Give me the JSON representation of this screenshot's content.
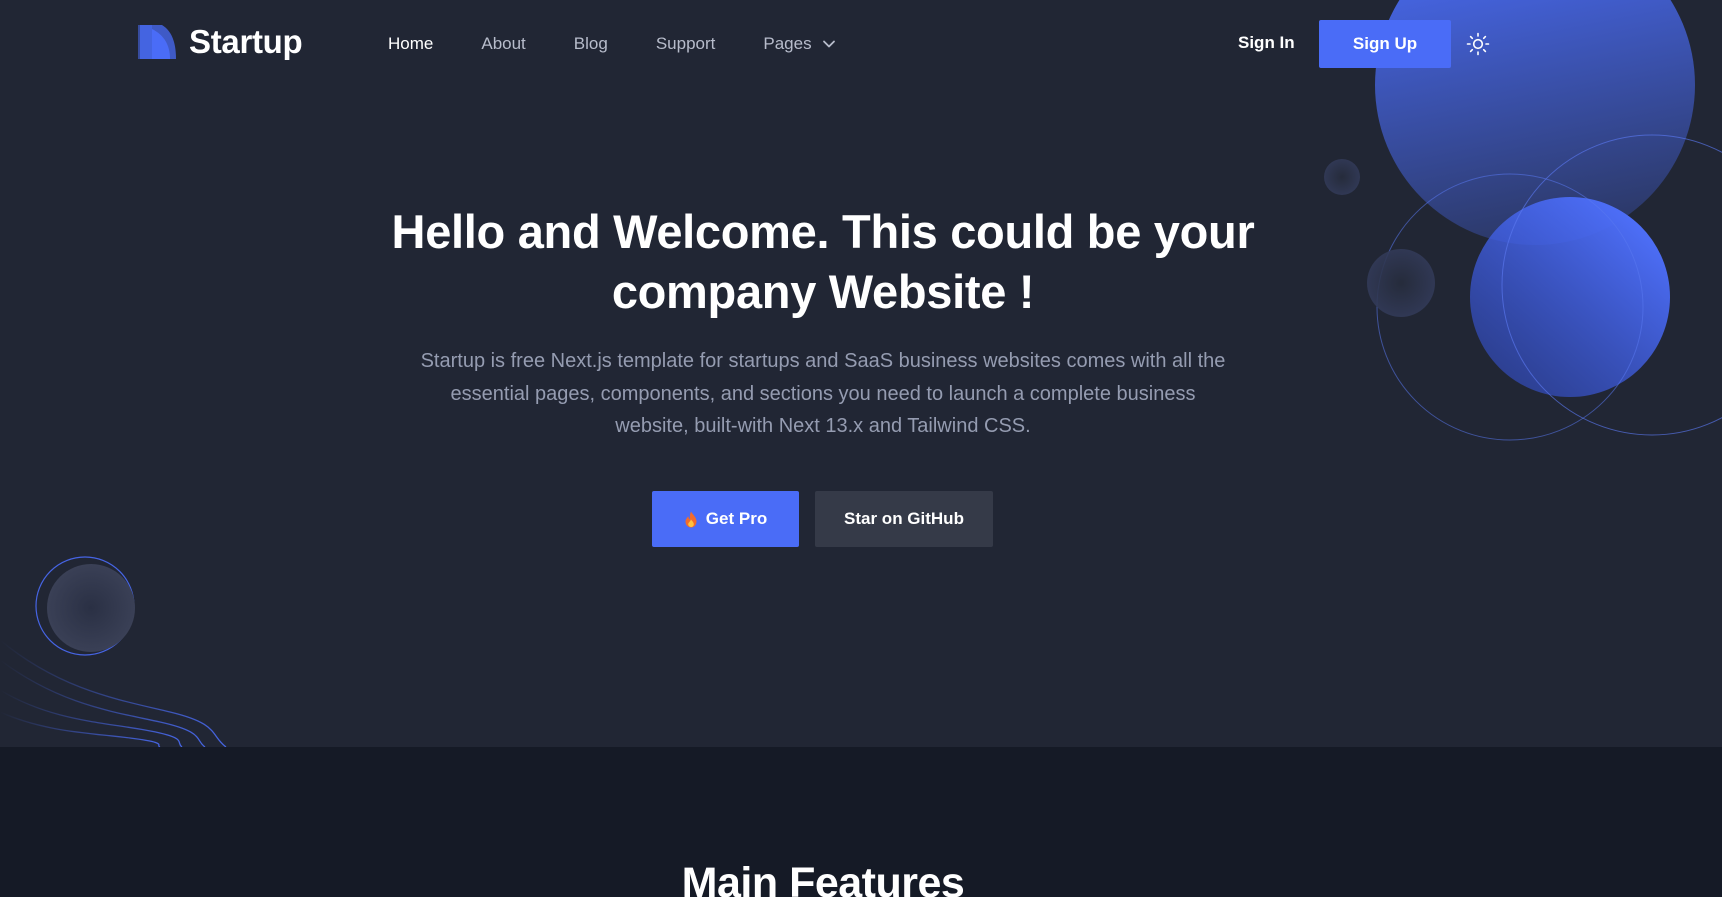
{
  "brand": {
    "name": "Startup",
    "accent": "#4a6cf7"
  },
  "nav": {
    "items": [
      {
        "label": "Home",
        "active": true
      },
      {
        "label": "About",
        "active": false
      },
      {
        "label": "Blog",
        "active": false
      },
      {
        "label": "Support",
        "active": false
      },
      {
        "label": "Pages",
        "active": false,
        "has_dropdown": true
      }
    ]
  },
  "auth": {
    "sign_in": "Sign In",
    "sign_up": "Sign Up"
  },
  "theme_toggle_icon": "sun-icon",
  "hero": {
    "title": "Hello and Welcome. This could be your company Website !",
    "description": "Startup is free Next.js template for startups and SaaS business websites comes with all the essential pages, components, and sections you need to launch a complete business website, built-with Next 13.x and Tailwind CSS.",
    "primary_button": "Get Pro",
    "primary_button_icon": "fire-icon",
    "secondary_button": "Star on GitHub"
  },
  "features": {
    "title": "Main Features"
  },
  "colors": {
    "hero_bg": "#212634",
    "features_bg": "#151a26",
    "secondary_button_bg": "#353a48",
    "muted_text": "#959cb1"
  }
}
